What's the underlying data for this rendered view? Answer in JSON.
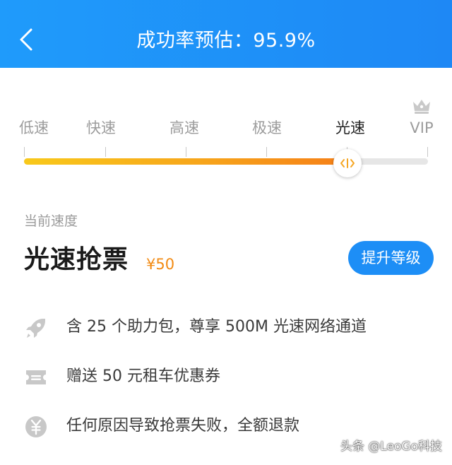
{
  "header": {
    "title": "成功率预估：95.9%",
    "back_icon": "chevron-left-icon",
    "background": "#1e8ff7"
  },
  "speed_levels": {
    "items": [
      "低速",
      "快速",
      "高速",
      "极速",
      "光速",
      "VIP"
    ],
    "active_index": 4,
    "vip_icon": "crown-icon",
    "progress_percent": 80,
    "fill_colors": [
      "#f8c91b",
      "#f57f17"
    ]
  },
  "current": {
    "caption": "当前速度",
    "name": "光速抢票",
    "price": "¥50",
    "upgrade_label": "提升等级",
    "price_color": "#f28a12",
    "button_color": "#1d8ef6"
  },
  "benefits": [
    {
      "icon": "rocket-icon",
      "text": "含 25 个助力包，尊享 500M 光速网络通道"
    },
    {
      "icon": "ticket-icon",
      "text": "赠送 50 元租车优惠券"
    },
    {
      "icon": "yen-icon",
      "text": "任何原因导致抢票失败，全额退款"
    }
  ],
  "watermark": "头条 @LeoGo科技"
}
